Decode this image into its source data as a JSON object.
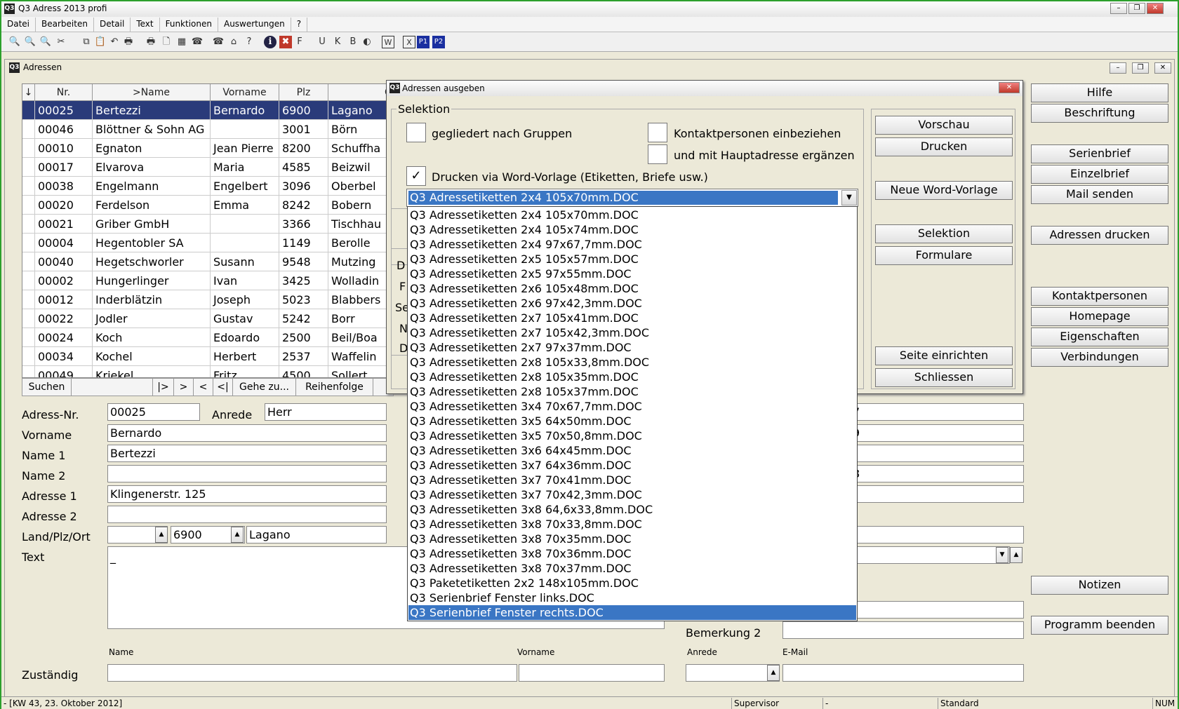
{
  "window": {
    "title": "Q3 Adress 2013 profi",
    "icon_text": "Q3",
    "min": "–",
    "max": "❐",
    "close": "✕"
  },
  "menu": [
    "Datei",
    "Bearbeiten",
    "Detail",
    "Text",
    "Funktionen",
    "Auswertungen",
    "?"
  ],
  "toolbar_icons": [
    "find-icon",
    "find-plus-icon",
    "find-minus-icon",
    "scissors-icon",
    "copy-icon",
    "paste-icon",
    "undo-icon",
    "print-icon",
    "printer-icon",
    "preview-icon",
    "export-icon",
    "phone-icon",
    "phone2-icon",
    "house-icon",
    "help-icon",
    "info-icon",
    "close-red-icon",
    "font-bold-icon",
    "underline-icon",
    "italic-icon",
    "font-icon",
    "contrast-icon",
    "word-icon",
    "excel-icon",
    "p1-icon",
    "p2-icon"
  ],
  "toolbar_glyphs": [
    "🔍",
    "🔍",
    "🔍",
    "✂",
    "⧉",
    "📋",
    "↶",
    "🖶",
    "🖶",
    "🗋",
    "▦",
    "☎",
    "☎",
    "⌂",
    "?",
    "ℹ",
    "✖",
    "F",
    "U",
    "K",
    "B",
    "◐",
    "W",
    "X",
    "P1",
    "P2"
  ],
  "mdi": {
    "title": "Adressen",
    "icon_text": "Q3"
  },
  "grid": {
    "sort_icon": "↓",
    "headers": [
      "Nr.",
      ">Name",
      "Vorname",
      "Plz",
      "O"
    ],
    "rows": [
      [
        "00025",
        "Bertezzi",
        "Bernardo",
        "6900",
        "Lagano"
      ],
      [
        "00046",
        "Blöttner & Sohn AG",
        "",
        "3001",
        "Börn"
      ],
      [
        "00010",
        "Egnaton",
        "Jean Pierre",
        "8200",
        "Schuffha"
      ],
      [
        "00017",
        "Elvarova",
        "Maria",
        "4585",
        "Beizwil"
      ],
      [
        "00038",
        "Engelmann",
        "Engelbert",
        "3096",
        "Oberbel"
      ],
      [
        "00020",
        "Ferdelson",
        "Emma",
        "8242",
        "Bobern"
      ],
      [
        "00021",
        "Griber GmbH",
        "",
        "3366",
        "Tischhau"
      ],
      [
        "00004",
        "Hegentobler SA",
        "",
        "1149",
        "Berolle"
      ],
      [
        "00040",
        "Hegetschworler",
        "Susann",
        "9548",
        "Mutzing"
      ],
      [
        "00002",
        "Hungerlinger",
        "Ivan",
        "3425",
        "Wolladin"
      ],
      [
        "00012",
        "Inderblätzin",
        "Joseph",
        "5023",
        "Blabbers"
      ],
      [
        "00022",
        "Jodler",
        "Gustav",
        "5242",
        "Borr"
      ],
      [
        "00024",
        "Koch",
        "Edoardo",
        "2500",
        "Beil/Boa"
      ],
      [
        "00034",
        "Kochel",
        "Herbert",
        "2537",
        "Waffelin"
      ],
      [
        "00049",
        "Kriekel",
        "Fritz",
        "4500",
        "Sollert"
      ]
    ]
  },
  "nav": {
    "search": "Suchen",
    "first": "|>",
    "next": ">",
    "prev": "<",
    "last": "<|",
    "goto": "Gehe zu...",
    "order": "Reihenfolge"
  },
  "form": {
    "nr_label": "Adress-Nr.",
    "nr": "00025",
    "anrede_label": "Anrede",
    "anrede": "Herr",
    "vorname_label": "Vorname",
    "vorname": "Bernardo",
    "name1_label": "Name 1",
    "name1": "Bertezzi",
    "name2_label": "Name 2",
    "name2": "",
    "adr1_label": "Adresse 1",
    "adr1": "Klingenerstr. 125",
    "adr2_label": "Adresse 2",
    "adr2": "",
    "lpo_label": "Land/Plz/Ort",
    "land": "",
    "plz": "6900",
    "ort": "Lagano",
    "text_label": "Text",
    "text": "_",
    "right1": "7",
    "right2": "9",
    "right4": "8",
    "bem2_label": "Bemerkung 2",
    "zust_label": "Zuständig",
    "col_name": "Name",
    "col_vorname": "Vorname",
    "col_anrede": "Anrede",
    "col_email": "E-Mail"
  },
  "right_buttons": [
    "Hilfe",
    "Beschriftung",
    "Serienbrief",
    "Einzelbrief",
    "Mail senden",
    "Adressen drucken",
    "Kontaktpersonen",
    "Homepage",
    "Eigenschaften",
    "Verbindungen",
    "Notizen",
    "Programm beenden"
  ],
  "dialog": {
    "title": "Adressen ausgeben",
    "close": "✕",
    "group_label": "Selektion",
    "chk1": "gegliedert nach Gruppen",
    "chk2": "Kontaktpersonen einbeziehen",
    "chk3": "und mit Hauptadresse ergänzen",
    "chk4": "Drucken via Word-Vorlage (Etiketten, Briefe usw.)",
    "chk4_mark": "✓",
    "combo_value": "Q3 Adressetiketten 2x4 105x70mm.DOC",
    "combo_arrow": "▼",
    "hidden_labels": [
      "D",
      "F",
      "Se",
      "N",
      "D"
    ],
    "buttons": [
      "Vorschau",
      "Drucken",
      "Neue Word-Vorlage",
      "Selektion",
      "Formulare",
      "Seite einrichten",
      "Schliessen"
    ]
  },
  "dropdown": [
    "Q3 Adressetiketten 2x4 105x70mm.DOC",
    "Q3 Adressetiketten 2x4 105x74mm.DOC",
    "Q3 Adressetiketten 2x4 97x67,7mm.DOC",
    "Q3 Adressetiketten 2x5 105x57mm.DOC",
    "Q3 Adressetiketten 2x5 97x55mm.DOC",
    "Q3 Adressetiketten 2x6 105x48mm.DOC",
    "Q3 Adressetiketten 2x6 97x42,3mm.DOC",
    "Q3 Adressetiketten 2x7 105x41mm.DOC",
    "Q3 Adressetiketten 2x7 105x42,3mm.DOC",
    "Q3 Adressetiketten 2x7 97x37mm.DOC",
    "Q3 Adressetiketten 2x8 105x33,8mm.DOC",
    "Q3 Adressetiketten 2x8 105x35mm.DOC",
    "Q3 Adressetiketten 2x8 105x37mm.DOC",
    "Q3 Adressetiketten 3x4 70x67,7mm.DOC",
    "Q3 Adressetiketten 3x5 64x50mm.DOC",
    "Q3 Adressetiketten 3x5 70x50,8mm.DOC",
    "Q3 Adressetiketten 3x6 64x45mm.DOC",
    "Q3 Adressetiketten 3x7 64x36mm.DOC",
    "Q3 Adressetiketten 3x7 70x41mm.DOC",
    "Q3 Adressetiketten 3x7 70x42,3mm.DOC",
    "Q3 Adressetiketten 3x8 64,6x33,8mm.DOC",
    "Q3 Adressetiketten 3x8 70x33,8mm.DOC",
    "Q3 Adressetiketten 3x8 70x35mm.DOC",
    "Q3 Adressetiketten 3x8 70x36mm.DOC",
    "Q3 Adressetiketten 3x8 70x37mm.DOC",
    "Q3 Paketetiketten 2x2 148x105mm.DOC",
    "Q3 Serienbrief Fenster links.DOC",
    "Q3 Serienbrief Fenster rechts.DOC"
  ],
  "status": {
    "date": "- [KW 43, 23. Oktober 2012]",
    "user": "Supervisor",
    "dash": "-",
    "mode": "Standard",
    "num": "NUM"
  }
}
